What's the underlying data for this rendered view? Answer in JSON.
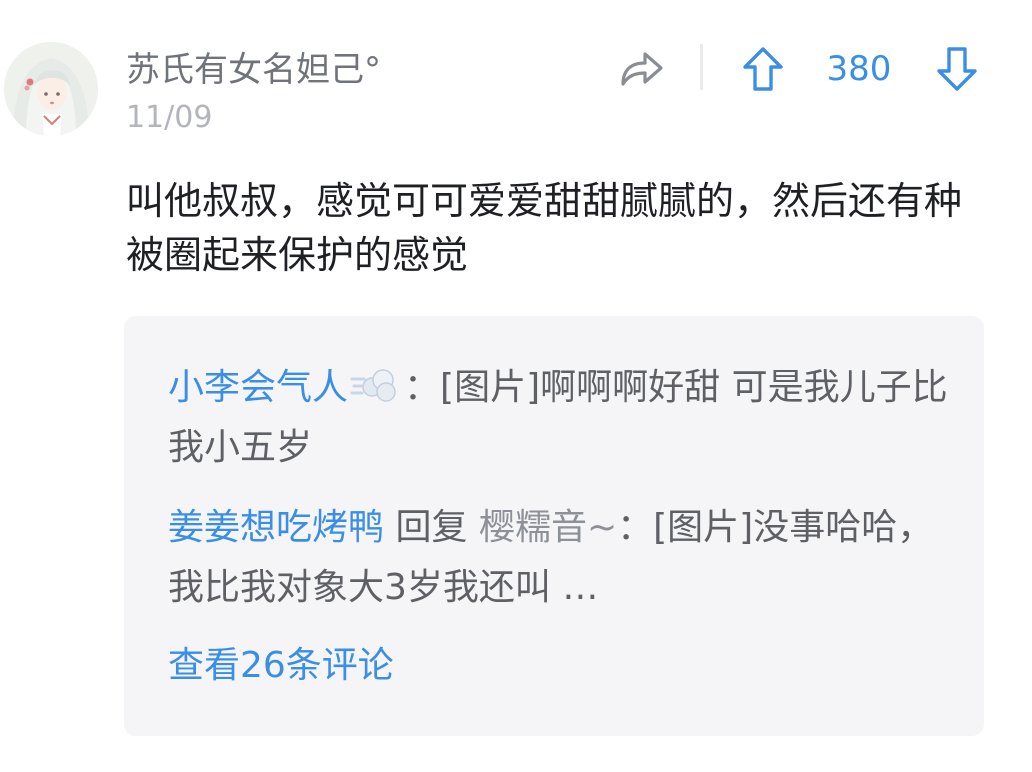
{
  "comment": {
    "username": "苏氏有女名妲己°",
    "date": "11/09",
    "body": "叫他叔叔，感觉可可爱爱甜甜腻腻的，然后还有种被圈起来保护的感觉",
    "actions": {
      "share_icon": "share-arrow-icon",
      "upvote_icon": "arrow-up-icon",
      "downvote_icon": "arrow-down-icon",
      "vote_count": "380"
    },
    "accent_color": "#3a8ee6"
  },
  "replies": [
    {
      "author": "小李会气人",
      "emoji_icon": "steam-puff-icon",
      "separator": "：",
      "text": "[图片]啊啊啊好甜 可是我儿子比我小五岁"
    },
    {
      "author": "姜姜想吃烤鸭",
      "reply_word": "回复",
      "target": "樱糯音~",
      "separator": "：",
      "text": "[图片]没事哈哈，我比我对象大3岁我还叫 …"
    }
  ],
  "view_all_label": "查看26条评论"
}
